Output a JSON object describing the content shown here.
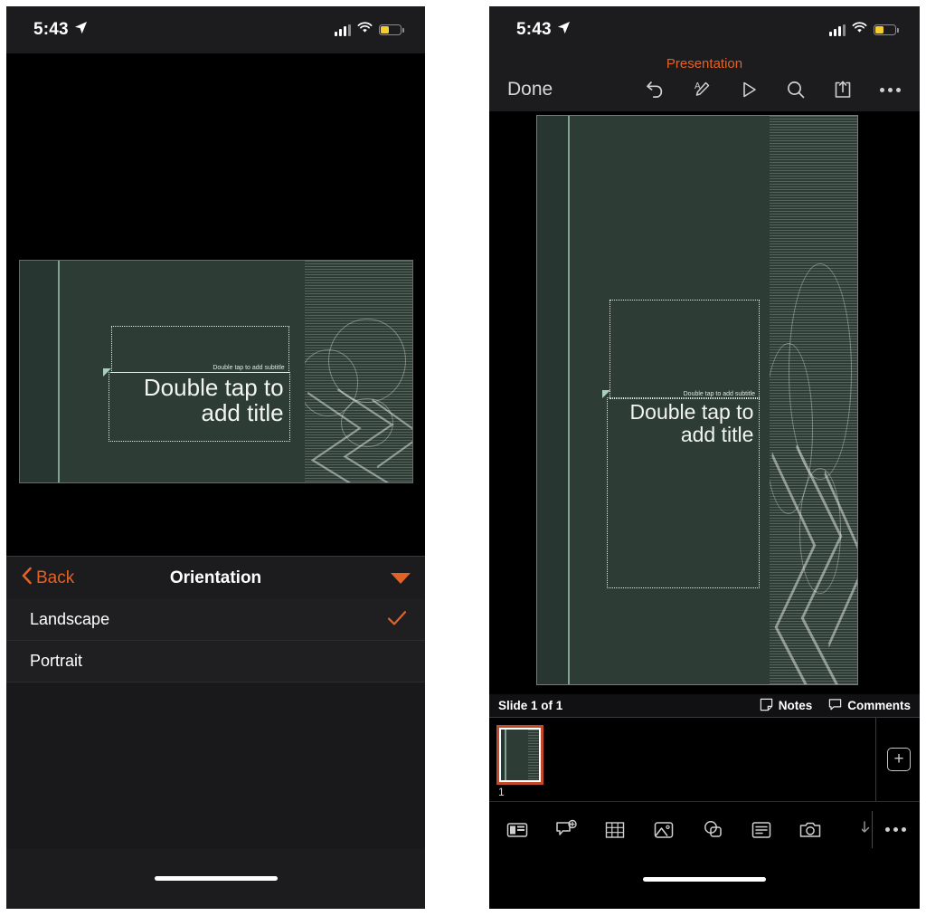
{
  "meta": {
    "accent_orange": "#e26226",
    "slide_bg_green": "#2d3d35",
    "panel_green_top": "#e2f0df",
    "panel_green_bottom": "#b2dc72",
    "battery_yellow": "#f5cc2e"
  },
  "status_bar": {
    "time": "5:43",
    "location_icon": "location-arrow-icon",
    "signal_icon": "cellular-signal-icon",
    "wifi_icon": "wifi-icon",
    "battery_icon": "battery-low-power-icon"
  },
  "slide_content": {
    "subtitle_placeholder": "Double tap to add subtitle",
    "title_placeholder": "Double tap to add title"
  },
  "left_panel": {
    "menu": {
      "back_label": "Back",
      "back_icon": "chevron-left-icon",
      "title": "Orientation",
      "collapse_icon": "triangle-down-icon",
      "options": [
        {
          "label": "Landscape",
          "selected": true,
          "check_icon": "checkmark-icon"
        },
        {
          "label": "Portrait",
          "selected": false,
          "check_icon": ""
        }
      ]
    }
  },
  "right_panel": {
    "doc_title": "Presentation",
    "toolbar": {
      "done_label": "Done",
      "icons": [
        {
          "name": "undo-icon"
        },
        {
          "name": "annotate-text-icon"
        },
        {
          "name": "play-slideshow-icon"
        },
        {
          "name": "search-icon"
        },
        {
          "name": "share-icon"
        },
        {
          "name": "more-options-icon"
        }
      ]
    },
    "slide_status": {
      "counter": "Slide 1 of 1",
      "notes_label": "Notes",
      "notes_icon": "notes-icon",
      "comments_label": "Comments",
      "comments_icon": "comment-bubble-icon"
    },
    "thumbnails": {
      "items": [
        {
          "number": "1",
          "selected": true
        }
      ],
      "add_icon": "add-slide-icon"
    },
    "bottom_toolbar": {
      "icons": [
        {
          "name": "new-slide-icon"
        },
        {
          "name": "add-comment-icon"
        },
        {
          "name": "insert-table-icon"
        },
        {
          "name": "insert-picture-icon"
        },
        {
          "name": "insert-shape-icon"
        },
        {
          "name": "insert-text-box-icon"
        },
        {
          "name": "insert-camera-icon"
        }
      ],
      "collapse_icon": "collapse-arrow-icon",
      "more_icon": "more-options-icon"
    }
  }
}
